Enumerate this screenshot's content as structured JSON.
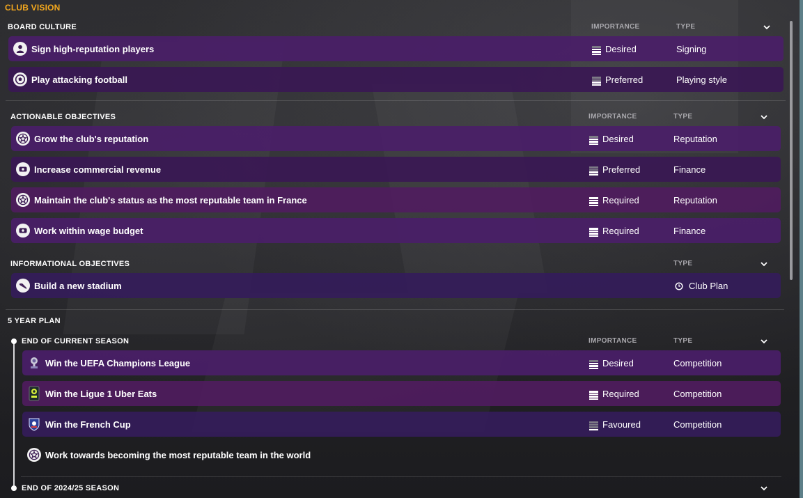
{
  "title": "CLUB VISION",
  "board_culture": {
    "heading": "BOARD CULTURE",
    "col_importance": "IMPORTANCE",
    "col_type": "TYPE",
    "rows": [
      {
        "label": "Sign high-reputation players",
        "importance": "Desired",
        "type": "Signing",
        "icon": "person-icon",
        "bars": 3
      },
      {
        "label": "Play attacking football",
        "importance": "Preferred",
        "type": "Playing style",
        "icon": "football-icon",
        "bars": 2
      }
    ]
  },
  "actionable": {
    "heading": "ACTIONABLE OBJECTIVES",
    "col_importance": "IMPORTANCE",
    "col_type": "TYPE",
    "rows": [
      {
        "label": "Grow the club's reputation",
        "importance": "Desired",
        "type": "Reputation",
        "icon": "star-icon",
        "bars": 3
      },
      {
        "label": "Increase commercial revenue",
        "importance": "Preferred",
        "type": "Finance",
        "icon": "money-icon",
        "bars": 2
      },
      {
        "label": "Maintain the club's status as the most reputable team in France",
        "importance": "Required",
        "type": "Reputation",
        "icon": "star-icon",
        "bars": 4
      },
      {
        "label": "Work within wage budget",
        "importance": "Required",
        "type": "Finance",
        "icon": "money-icon",
        "bars": 4
      }
    ]
  },
  "informational": {
    "heading": "INFORMATIONAL OBJECTIVES",
    "col_type": "TYPE",
    "rows": [
      {
        "label": "Build a new stadium",
        "type": "Club Plan",
        "icon": "stadium-icon",
        "type_icon": "clock-icon"
      }
    ]
  },
  "five_year_plan": {
    "heading": "5 YEAR PLAN",
    "current": {
      "heading": "END OF CURRENT SEASON",
      "col_importance": "IMPORTANCE",
      "col_type": "TYPE",
      "rows": [
        {
          "label": "Win the UEFA Champions League",
          "importance": "Desired",
          "type": "Competition",
          "icon": "champions-league-trophy-icon",
          "bars": 3
        },
        {
          "label": "Win the Ligue 1 Uber Eats",
          "importance": "Required",
          "type": "Competition",
          "icon": "ligue1-logo-icon",
          "bars": 4
        },
        {
          "label": "Win the French Cup",
          "importance": "Favoured",
          "type": "Competition",
          "icon": "french-cup-logo-icon",
          "bars": 1
        },
        {
          "label": "Work towards becoming the most reputable team in the world",
          "icon": "star-icon"
        }
      ]
    },
    "next": {
      "heading": "END OF 2024/25 SEASON"
    }
  },
  "colors": {
    "accent": "#f4a81d",
    "row_purple": "#4a1e68",
    "side_strip": "#5d7f88"
  }
}
